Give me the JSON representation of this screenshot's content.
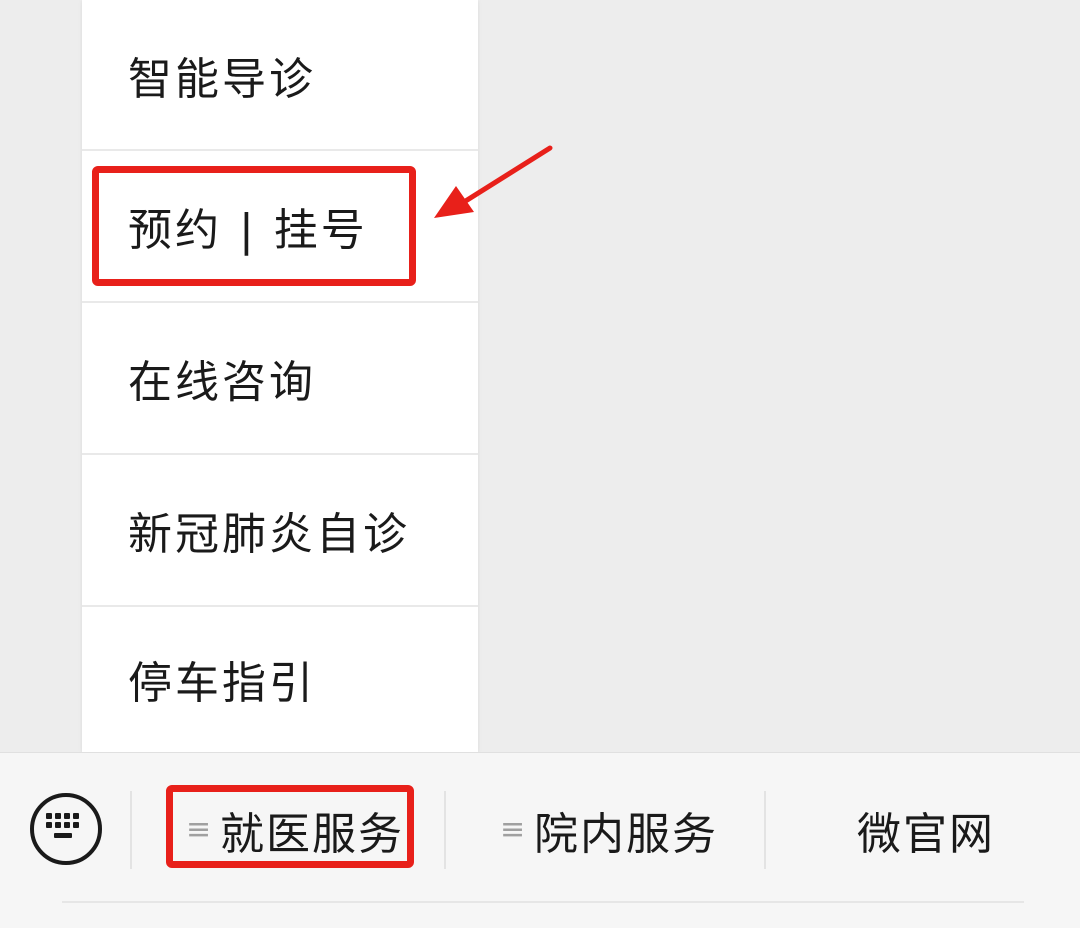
{
  "submenu": {
    "items": [
      {
        "label": "智能导诊"
      },
      {
        "label": "预约 | 挂号"
      },
      {
        "label": "在线咨询"
      },
      {
        "label": "新冠肺炎自诊"
      },
      {
        "label": "停车指引"
      }
    ]
  },
  "menubar": {
    "keyboard_icon": "keyboard-icon",
    "tabs": [
      {
        "label": "就医服务",
        "icon": "list-icon"
      },
      {
        "label": "院内服务",
        "icon": "list-icon"
      },
      {
        "label": "微官网"
      }
    ]
  },
  "annotation": {
    "color": "#e8201a"
  },
  "colors": {
    "background": "#ededed",
    "menu_bg": "#ffffff",
    "bar_bg": "#f6f6f6"
  }
}
